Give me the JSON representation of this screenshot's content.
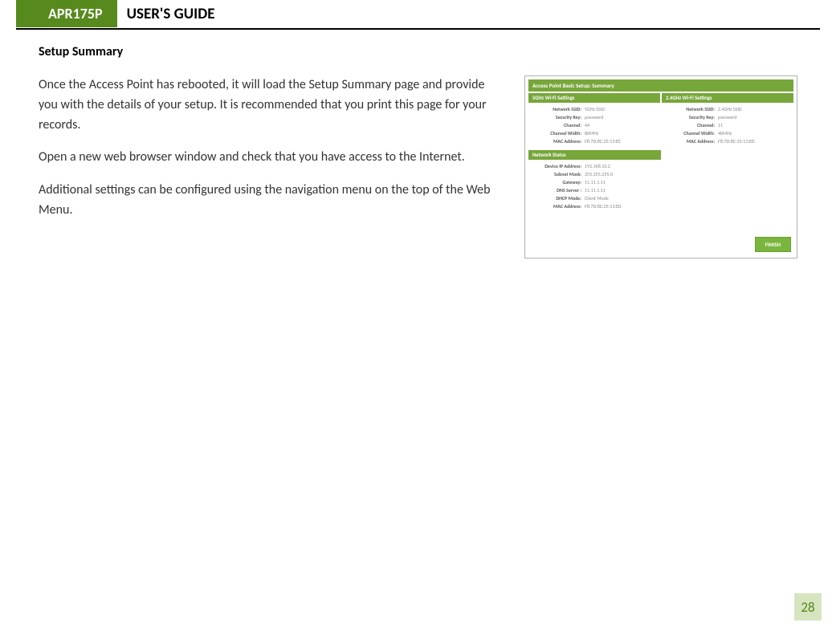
{
  "header": {
    "model": "APR175P",
    "title": "USER'S GUIDE"
  },
  "section": {
    "heading": "Setup Summary",
    "para1": "Once the Access Point has rebooted, it will load the Setup Summary page and provide you with the details of your setup. It is recommended that you print this page for your records.",
    "para2": "Open a new web browser window and check that you have access to the Internet.",
    "para3": "Additional settings can be configured using the navigation menu on the top of the Web Menu."
  },
  "figure": {
    "main_header": "Access Point Basic Setup: Summary",
    "panel5g": {
      "title": "5GHz Wi-Fi Settings",
      "rows": [
        {
          "label": "Network SSID:",
          "value": "5GHz SSID"
        },
        {
          "label": "Security Key:",
          "value": "password"
        },
        {
          "label": "Channel:",
          "value": "44"
        },
        {
          "label": "Channel Width:",
          "value": "80MHz"
        },
        {
          "label": "MAC Address:",
          "value": "F8:7D:8C:25:13:EC"
        }
      ]
    },
    "panel2g": {
      "title": "2.4GHz Wi-Fi Settings",
      "rows": [
        {
          "label": "Network SSID:",
          "value": "2.4GHz SSID"
        },
        {
          "label": "Security Key:",
          "value": "password"
        },
        {
          "label": "Channel:",
          "value": "11"
        },
        {
          "label": "Channel Width:",
          "value": "40MHz"
        },
        {
          "label": "MAC Address:",
          "value": "F8:7D:8C:25:13:ED"
        }
      ]
    },
    "panelNet": {
      "title": "Network Status",
      "rows": [
        {
          "label": "Device IP Address:",
          "value": "192.168.10.2"
        },
        {
          "label": "Subnet Mask:",
          "value": "255.255.255.0"
        },
        {
          "label": "Gateway:",
          "value": "11.11.1.11"
        },
        {
          "label": "DNS Server :",
          "value": "11.11.1.11"
        },
        {
          "label": "DHCP Mode:",
          "value": "Client Mode"
        },
        {
          "label": "MAC Address:",
          "value": "F8:7D:8C:25:13:ED"
        }
      ]
    },
    "finish": "FINISH"
  },
  "pageNumber": "28"
}
